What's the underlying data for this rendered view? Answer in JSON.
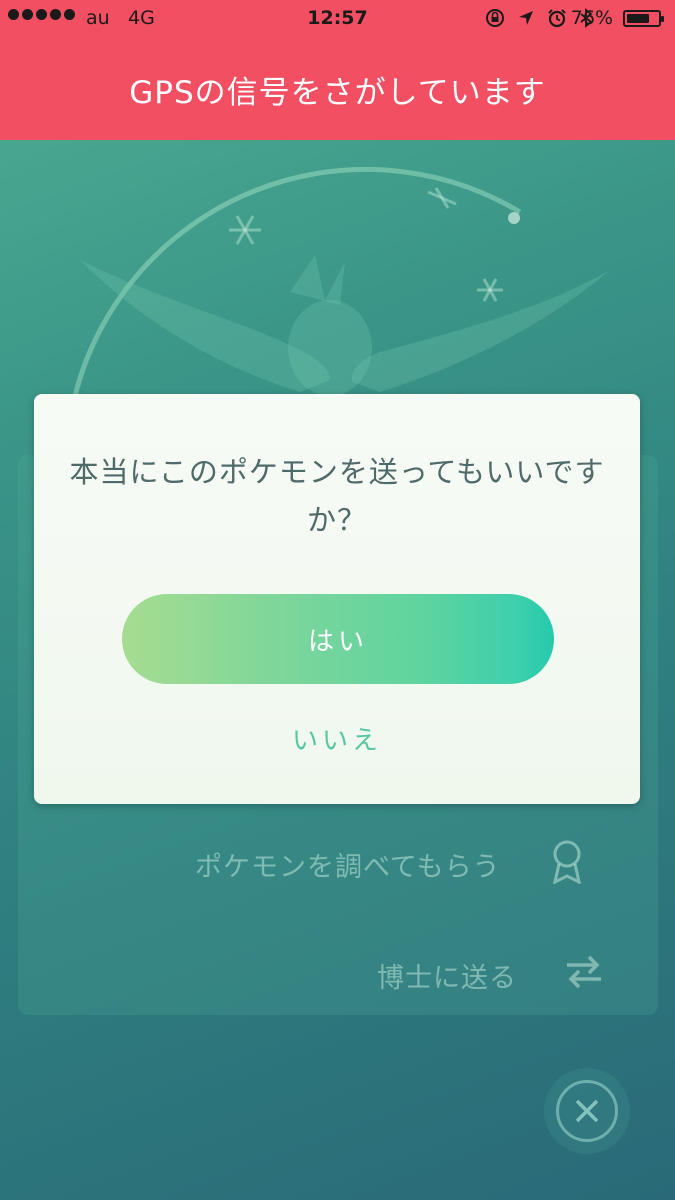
{
  "status_bar": {
    "signal_dots": 5,
    "carrier": "au",
    "network": "4G",
    "time": "12:57",
    "battery_percent": "76%",
    "battery_level": 0.76,
    "icons": [
      "rotation-lock-icon",
      "location-arrow-icon",
      "alarm-icon",
      "bluetooth-icon"
    ]
  },
  "banner": {
    "text": "GPSの信号をさがしています",
    "color": "#f24f62"
  },
  "background_menu": {
    "appraise_label": "ポケモンを調べてもらう",
    "appraise_icon": "ribbon-medal-icon",
    "transfer_label": "博士に送る",
    "transfer_icon": "swap-arrows-icon",
    "close_icon": "close-icon"
  },
  "dialog": {
    "message": "本当にこのポケモンを送ってもいいですか？",
    "yes_label": "はい",
    "no_label": "いいえ",
    "accent_color": "#3ccfac"
  }
}
